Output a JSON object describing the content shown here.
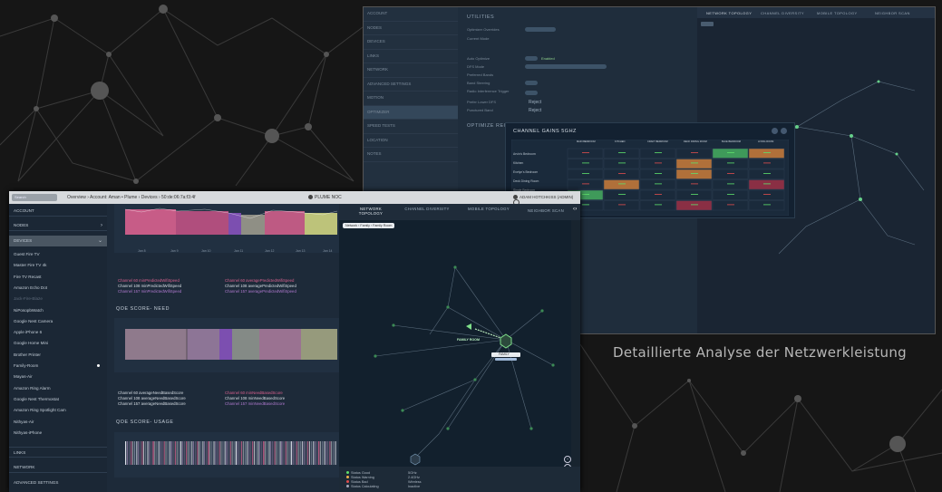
{
  "caption": "Detaillierte Analyse der Netzwerkleistung",
  "colors": {
    "accent_green": "#7fe08a",
    "pink": "#d9628f",
    "purple": "#7c4fb0",
    "olive": "#bdc37a",
    "good": "#5ee06b",
    "warning": "#f1b24a",
    "bad": "#e04d4d"
  },
  "back": {
    "sidebar": [
      "ACCOUNT",
      "NODES",
      "DEVICES",
      "LINKS",
      "NETWORK",
      "ADVANCED SETTINGS",
      "MOTION",
      "OPTIMIZER",
      "SPEED TESTS",
      "LOCATION",
      "NOTES"
    ],
    "utilities_title": "UTILITIES",
    "optimize_title": "OPTIMIZE REQUESTS",
    "labels": [
      "Optimizer Overrides",
      "Current Mode",
      "Auto Optimize",
      "DFS Mode",
      "Preferred Bands",
      "Band Steering",
      "Radio Interference Trigger",
      "Prefer Lower DFS",
      "Punctured Band"
    ],
    "options": {
      "enabled": "Enabled",
      "reject1": "Reject",
      "reject2": "Reject"
    },
    "tabs": [
      "NETWORK TOPOLOGY",
      "CHANNEL DIVERSITY",
      "MOBILE TOPOLOGY",
      "NEIGHBOR SCAN"
    ],
    "heatmap": {
      "title": "CHANNEL GAINS 5GHZ",
      "rows": [
        "Arvin's Bedroom",
        "Kitchen",
        "Evelyn's Bedroom",
        "Deck Dining Room",
        "Single Bedroom",
        "Family Room"
      ],
      "cols": [
        "MAIN BEDROOM",
        "KITCHEN",
        "CRAFT BEDROOM",
        "DECK DINING ROOM",
        "BLUE BEDROOM",
        "LIVING ROOM"
      ]
    }
  },
  "front": {
    "topbar": {
      "search": "Search",
      "crumb": "Overview  ›  Account: Aman • Plume  ›  Devices  ›  50:de:06:7a:f3:4f",
      "noc": "PLUME NOC",
      "user": "ADAM HOTCHKISS (ADMIN)"
    },
    "sidebar": {
      "account": "ACCOUNT",
      "nodes": "NODES",
      "devices": "DEVICES",
      "device_list": [
        "Guest Fire TV",
        "Master Fire TV 4k",
        "Fire TV Recast",
        "Amazon Echo Dot",
        "Jack-Fire-Blaze",
        "NiPosopbWatch",
        "Google Nest Camera",
        "Apple iPhone 6",
        "Google Home Mini",
        "Brother Printer",
        "Family-Room",
        "Mayas-Air",
        "Amazon Ring Alarm",
        "Google Nest Thermostat",
        "Amazon Ring Spotlight Cam",
        "Nithyas-Air",
        "Nithyas-iPhone"
      ],
      "links": "LINKS",
      "network": "NETWORK",
      "advanced": "ADVANCED SETTINGS"
    },
    "dates": [
      "Jan 8",
      "Jan 9",
      "Jan 10",
      "Jan 11",
      "Jan 12",
      "Jan 13",
      "Jan 14"
    ],
    "legend1": [
      "Channel 60 minPredictedWifiSpeed",
      "Channel 60 averagePredictedWifiSpeed",
      "Channel 108 minPredictedWifiSpeed",
      "Channel 108 averagePredictedWifiSpeed",
      "Channel 157 minPredictedWifiSpeed",
      "Channel 157 averagePredictedWifiSpeed"
    ],
    "qoe_need": "QOE SCORE- NEED",
    "legend2": [
      "Channel 60 averageNeedBasedScore",
      "Channel 60 minNeedBasedScore",
      "Channel 108 averageNeedBasedScore",
      "Channel 108 minNeedBasedScore",
      "Channel 157 averageNeedBasedScore",
      "Channel 157 minNeedBasedScore"
    ],
    "qoe_usage": "QOE SCORE- USAGE",
    "tabs": [
      "NETWORK TOPOLOGY",
      "CHANNEL DIVERSITY",
      "MOBILE TOPOLOGY",
      "NEIGHBOR SCAN"
    ],
    "map_crumb": "Network  ›  Family  ›  Family Room",
    "map_labels": {
      "family_room": "FAMILY ROOM",
      "family": "FAMILY"
    },
    "status": [
      {
        "label": "Status Good",
        "value": "5GHz"
      },
      {
        "label": "Status Warning",
        "value": "2.4GHz"
      },
      {
        "label": "Status Bad",
        "value": "Wireless"
      },
      {
        "label": "Status Calculating",
        "value": "Inactive"
      }
    ]
  }
}
